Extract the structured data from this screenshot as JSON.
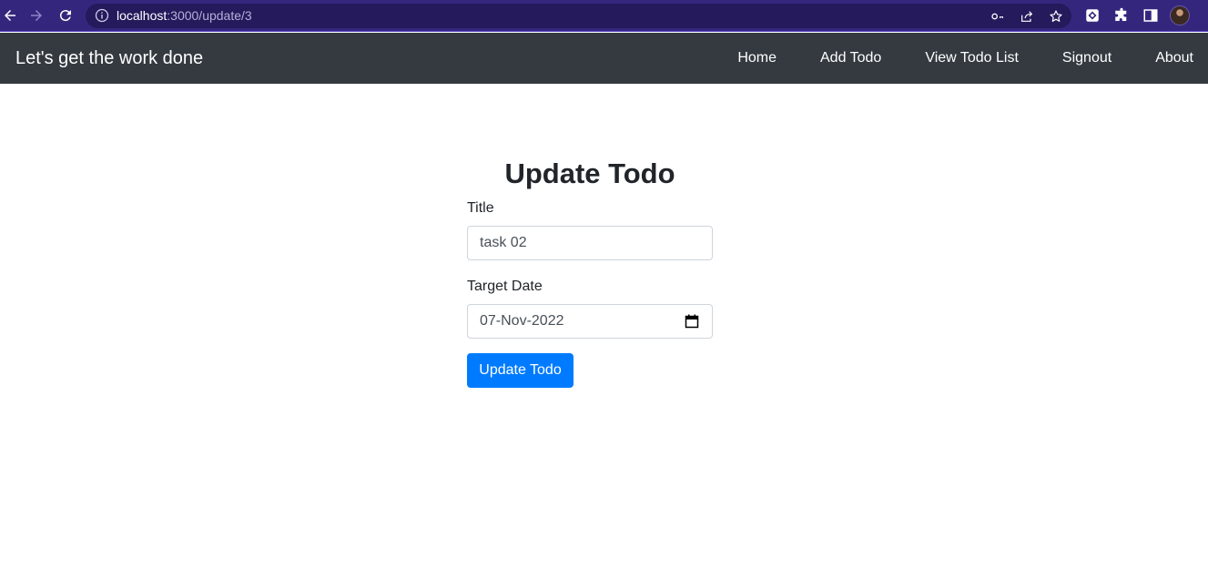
{
  "browser": {
    "url_host": "localhost",
    "url_path": ":3000/update/3",
    "icons": [
      "back-icon",
      "forward-icon",
      "reload-icon",
      "info-icon",
      "key-icon",
      "share-icon",
      "star-icon",
      "extension-icon",
      "puzzle-icon",
      "side-panel-icon",
      "avatar"
    ],
    "chrome_color": "#35267d"
  },
  "navbar": {
    "brand": "Let's get the work done",
    "links": [
      "Home",
      "Add Todo",
      "View Todo List",
      "Signout",
      "About"
    ],
    "background": "#343a40"
  },
  "form": {
    "heading": "Update Todo",
    "title_label": "Title",
    "title_value": "task 02",
    "date_label": "Target Date",
    "date_value": "07-Nov-2022",
    "submit_label": "Update Todo",
    "button_color": "#007bff"
  }
}
